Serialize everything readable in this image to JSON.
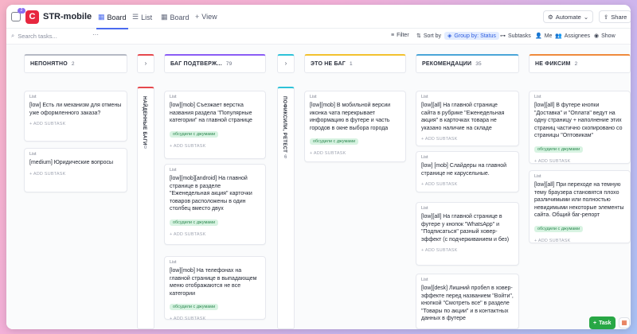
{
  "header": {
    "space_name": "STR-mobile",
    "space_logo": "C",
    "notif_count": "2",
    "tabs": [
      {
        "label": "Board",
        "icon": "board-icon",
        "active": true
      },
      {
        "label": "List",
        "icon": "list-icon",
        "active": false
      },
      {
        "label": "Board",
        "icon": "board-icon",
        "active": false
      }
    ],
    "add_view": "View",
    "automate": "Automate",
    "share": "Share"
  },
  "toolbar": {
    "search_placeholder": "Search tasks...",
    "filter": "Filter",
    "sort": "Sort by",
    "group": "Group by: Status",
    "subtasks": "Subtasks",
    "me": "Me",
    "assignees": "Assignees",
    "show": "Show"
  },
  "columns": [
    {
      "name": "НЕПОНЯТНО",
      "count": "2",
      "color": "#b5b9c4"
    },
    {
      "name": "БАГ ПОДТВЕРЖ...",
      "count": "79",
      "color": "#8a5cf5"
    },
    {
      "name": "ЭТО НЕ БАГ",
      "count": "1",
      "color": "#f2c12e"
    },
    {
      "name": "РЕКОМЕНДАЦИИ",
      "count": "35",
      "color": "#4aa5d8"
    },
    {
      "name": "НЕ ФИКСИМ",
      "count": "2",
      "color": "#ef8a3c"
    }
  ],
  "collapsed": [
    {
      "name": "НАЙДЕННЫЕ БАГИ",
      "count": "0",
      "color": "#e5484d"
    },
    {
      "name": "ПОФИКСИЛИ, РЕТЕСТ",
      "count": "6",
      "color": "#2ec2d8"
    }
  ],
  "cards": {
    "c1": {
      "list": "List",
      "title": "[low] Есть ли механизм для отмены уже оформленного заказа?"
    },
    "c2": {
      "list": "List",
      "title": "[medium] Юридические вопросы"
    },
    "c3": {
      "list": "List",
      "title": "[low][mob] Съезжает верстка названия раздела \"Популярные категории\" на главной странице",
      "tag": "обсудили с джумами"
    },
    "c4": {
      "list": "List",
      "title": "[low][mob][android] На главной странице в разделе \"Еженедельная акция\" карточки товаров расположены в один столбец вместо двух",
      "tag": "обсудили с джумами"
    },
    "c5": {
      "list": "List",
      "title": "[low][mob] На телефонах на главной странице в выпадающем меню отображаются не все категории",
      "tag": "обсудили с джумами"
    },
    "c6": {
      "list": "List",
      "title": "[low][mob] В мобильной версии иконка чата перекрывает информацию в футере и часть городов в окне выбора города",
      "tag": "обсудили с джумами"
    },
    "c7": {
      "list": "List",
      "title": "[low][all] На главной странице сайта в рубрике \"Еженедельная акция\" в карточках товара не указано наличие на складе"
    },
    "c8": {
      "list": "List",
      "title": "[low] [mob] Слайдеры на главной странице не карусельные."
    },
    "c9": {
      "list": "List",
      "title": "[low][all] На главной странице в футере у кнопок \"WhatsApp\" и \"Подписаться\" разный ховер-эффект (с подчеркиванием и без)"
    },
    "c10": {
      "list": "List",
      "title": "[low][desk] Лишний пробел в ховер-эффекте перед названием \"Войти\", кнопкой \"Смотреть все\" в разделе \"Товары по акции\" и в контактных данных в футере"
    },
    "c11": {
      "list": "List",
      "title": "[low][all] В футере кнопки \"Доставка\" и \"Оплата\" ведут на одну страницу + наполнение этих страниц частично скопировано со страницы \"Оптовикам\"",
      "tag": "обсудили с джумами"
    },
    "c12": {
      "list": "List",
      "title": "[low][all] При переходе на темную тему браузера становятся плохо различимыми или полностью невидимыми некоторые элементы сайта. Общий баг-репорт",
      "tag": "обсудили с джумами"
    }
  },
  "add_subtask": "+ ADD SUBTASK",
  "fab": {
    "task": "Task"
  }
}
